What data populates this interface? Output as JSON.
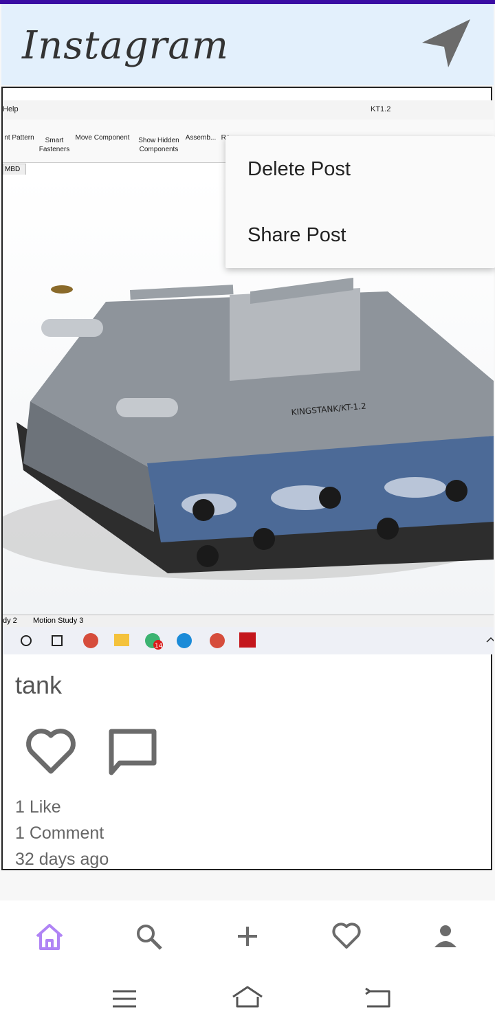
{
  "app": {
    "title": "Instagram"
  },
  "cad": {
    "help_label": "Help",
    "document_title": "KT1.2",
    "ribbon": [
      "nt Pattern",
      "Smart Fasteners",
      "Move Component",
      "Show Hidden Components",
      "Assemb...",
      "Re"
    ],
    "tab_label": "MBD",
    "status_tabs": [
      "dy 2",
      "Motion Study 3"
    ],
    "hull_text": "KINGSTANK/KT-1.2",
    "taskbar_badge": "14"
  },
  "post": {
    "caption": "tank",
    "likes_text": "1 Like",
    "comments_text": "1 Comment",
    "age_text": "32 days ago"
  },
  "menu": {
    "items": [
      "Delete Post",
      "Share Post"
    ]
  },
  "nav": {
    "active_color": "#b084f5",
    "items": [
      "home-icon",
      "search-icon",
      "add-icon",
      "heart-icon",
      "profile-icon"
    ]
  }
}
